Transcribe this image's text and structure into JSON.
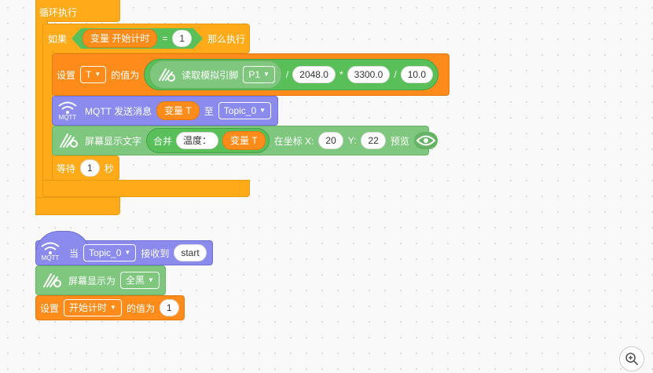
{
  "loop_block": {
    "label": "循环执行"
  },
  "if_block": {
    "if_label": "如果",
    "var_label": "变量 开始计时",
    "eq": "=",
    "value": "1",
    "then_label": "那么执行"
  },
  "set_t_block": {
    "set_label": "设置",
    "var": "T",
    "value_label": "的值为",
    "analog_label": "读取模拟引脚",
    "pin": "P1",
    "div1": "/",
    "n1": "2048.0",
    "mul": "*",
    "n2": "3300.0",
    "div2": "/",
    "n3": "10.0"
  },
  "mqtt_send_block": {
    "mqtt_tag": "MQTT",
    "label": "MQTT 发送消息",
    "var": "变量 T",
    "to": "至",
    "topic": "Topic_0"
  },
  "screen_text_block": {
    "label": "屏幕显示文字",
    "join": "合并",
    "text1": "温度：",
    "var": "变量 T",
    "pos_label": "在坐标 X:",
    "x": "20",
    "y_label": "Y:",
    "y": "22",
    "preview": "预览"
  },
  "wait_block": {
    "label": "等待",
    "value": "1",
    "unit": "秒"
  },
  "mqtt_receive_block": {
    "mqtt_tag": "MQTT",
    "when": "当",
    "topic": "Topic_0",
    "received": "接收到",
    "msg": "start"
  },
  "screen_display_block": {
    "label": "屏幕显示为",
    "option": "全黑"
  },
  "set_timer_block": {
    "set_label": "设置",
    "var": "开始计时",
    "value_label": "的值为",
    "value": "1"
  },
  "colors": {
    "orange": "#ffab19",
    "variable_orange": "#ff8c1a",
    "green": "#59c059",
    "light_green": "#7fc77f",
    "purple": "#8b8bee"
  },
  "icons": {
    "wifi": "wifi-icon",
    "display": "display-icon",
    "eye": "eye-icon",
    "zoom": "zoom-in-icon"
  }
}
